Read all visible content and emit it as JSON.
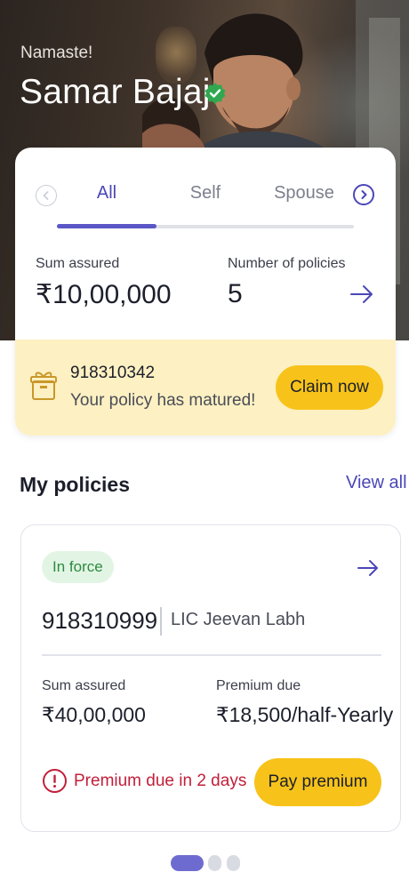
{
  "header": {
    "greeting": "Namaste!",
    "user_name": "Samar Bajaj",
    "verified_icon": "verified-check-icon"
  },
  "summary": {
    "tabs": [
      {
        "label": "All",
        "active": true
      },
      {
        "label": "Self",
        "active": false
      },
      {
        "label": "Spouse",
        "active": false
      }
    ],
    "sum_assured_label": "Sum assured",
    "sum_assured_value": "₹10,00,000",
    "policies_count_label": "Number of policies",
    "policies_count_value": "5"
  },
  "matured_banner": {
    "policy_number": "918310342",
    "message": "Your policy has matured!",
    "cta_label": "Claim now"
  },
  "my_policies": {
    "title": "My policies",
    "view_all_label": "View all",
    "policy": {
      "status": "In force",
      "number": "918310999",
      "plan_name": "LIC Jeevan Labh",
      "sum_assured_label": "Sum assured",
      "sum_assured_value": "₹40,00,000",
      "premium_due_label": "Premium due",
      "premium_amount": "₹18,500",
      "premium_frequency": "/half-Yearly",
      "alert_text": "Premium due in 2 days",
      "cta_label": "Pay premium"
    },
    "carousel": {
      "pages": 3,
      "active_page": 1
    }
  },
  "colors": {
    "accent": "#4b47b8",
    "cta_yellow": "#f7c31a",
    "banner_bg": "#fdf0c2",
    "status_green": "#2e8a3f",
    "alert_red": "#c21f3a",
    "verified_green": "#2fa84f"
  }
}
